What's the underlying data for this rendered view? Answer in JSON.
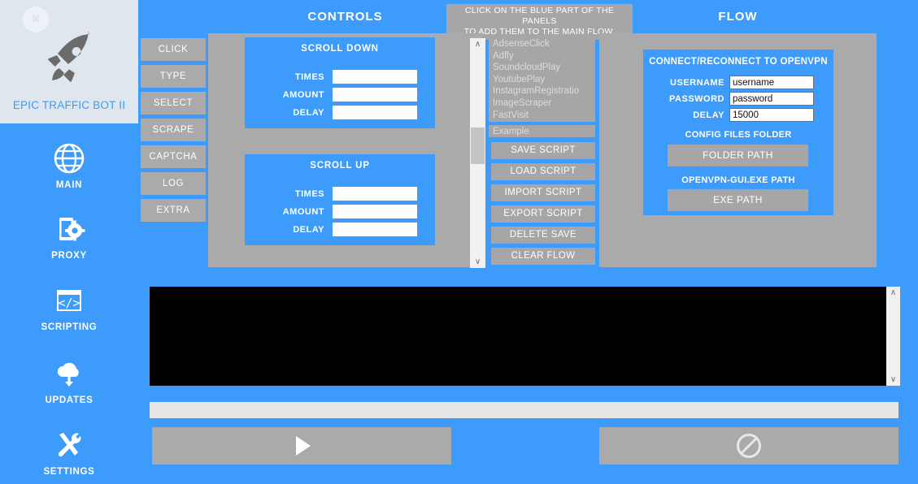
{
  "app": {
    "title": "EPIC TRAFFIC BOT II",
    "close_label": "✖",
    "rocket_icon": "rocket-icon"
  },
  "sidebar": {
    "items": [
      {
        "label": "MAIN",
        "icon": "globe-icon"
      },
      {
        "label": "PROXY",
        "icon": "phone-gear-icon"
      },
      {
        "label": "SCRIPTING",
        "icon": "code-window-icon"
      },
      {
        "label": "UPDATES",
        "icon": "cloud-download-icon"
      },
      {
        "label": "SETTINGS",
        "icon": "tools-icon"
      }
    ]
  },
  "hint": {
    "line1": "CLICK ON THE BLUE PART OF THE PANELS",
    "line2": "TO ADD THEM TO THE MAIN FLOW."
  },
  "panels": {
    "controls_title": "CONTROLS",
    "flow_title": "FLOW"
  },
  "actions": [
    {
      "label": "CLICK"
    },
    {
      "label": "TYPE"
    },
    {
      "label": "SELECT"
    },
    {
      "label": "SCRAPE"
    },
    {
      "label": "CAPTCHA"
    },
    {
      "label": "LOG"
    },
    {
      "label": "EXTRA"
    }
  ],
  "scroll_down": {
    "title": "SCROLL DOWN",
    "times_label": "TIMES",
    "times_value": "",
    "amount_label": "AMOUNT",
    "amount_value": "",
    "delay_label": "DELAY",
    "delay_value": ""
  },
  "scroll_up": {
    "title": "SCROLL UP",
    "times_label": "TIMES",
    "times_value": "",
    "amount_label": "AMOUNT",
    "amount_value": "",
    "delay_label": "DELAY",
    "delay_value": ""
  },
  "script_list": {
    "items": [
      "AdsenseClick",
      "Adfly",
      " SoundcloudPlay",
      "YoutubePlay",
      "InstagramRegistratio",
      "ImageScraper",
      " FastVisit"
    ],
    "name_value": "Example",
    "up_arrow": "∧",
    "down_arrow": "∨"
  },
  "script_buttons": [
    {
      "label": "SAVE SCRIPT"
    },
    {
      "label": "LOAD SCRIPT"
    },
    {
      "label": "IMPORT SCRIPT"
    },
    {
      "label": "EXPORT SCRIPT"
    },
    {
      "label": "DELETE SAVE"
    },
    {
      "label": "CLEAR FLOW"
    }
  ],
  "openvpn": {
    "title": "CONNECT/RECONNECT TO OPENVPN",
    "username_label": "USERNAME",
    "username_value": "username",
    "password_label": "PASSWORD",
    "password_value": "password",
    "delay_label": "DELAY",
    "delay_value": "15000",
    "config_title": "CONFIG FILES FOLDER",
    "folder_button": "FOLDER PATH",
    "exe_title": "OPENVPN-GUI.EXE PATH",
    "exe_button": "EXE PATH"
  },
  "console": {
    "text": ""
  },
  "footer": {
    "run_icon": "play-icon",
    "stop_icon": "prohibition-icon",
    "progress_value": ""
  },
  "colors": {
    "blue": "#3d9bfc",
    "gray": "#aaaaaa",
    "panel_gray": "#a6a6a6",
    "header_bg": "#dfe6ed",
    "white": "#ffffff",
    "console_bg": "#000000"
  }
}
